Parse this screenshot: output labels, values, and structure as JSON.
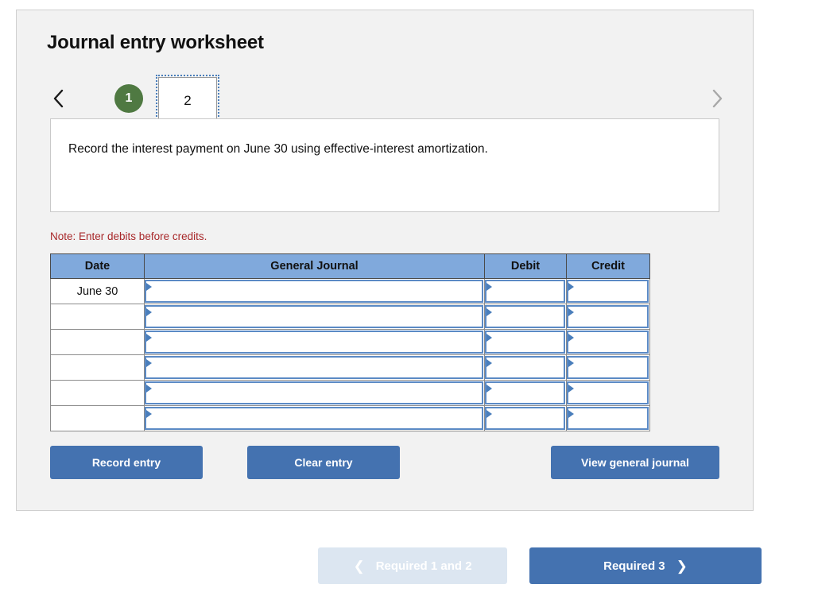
{
  "panel": {
    "title": "Journal entry worksheet"
  },
  "tabs": {
    "prev_icon": "chevron-left-icon",
    "next_icon": "chevron-right-icon",
    "items": [
      {
        "label": "1",
        "state": "completed"
      },
      {
        "label": "2",
        "state": "active"
      }
    ]
  },
  "instruction": {
    "text": "Record the interest payment on June 30 using effective-interest amortization."
  },
  "note": {
    "text": "Note: Enter debits before credits."
  },
  "journal": {
    "columns": [
      "Date",
      "General Journal",
      "Debit",
      "Credit"
    ],
    "rows": [
      {
        "date": "June 30",
        "general_journal": "",
        "debit": "",
        "credit": ""
      },
      {
        "date": "",
        "general_journal": "",
        "debit": "",
        "credit": ""
      },
      {
        "date": "",
        "general_journal": "",
        "debit": "",
        "credit": ""
      },
      {
        "date": "",
        "general_journal": "",
        "debit": "",
        "credit": ""
      },
      {
        "date": "",
        "general_journal": "",
        "debit": "",
        "credit": ""
      },
      {
        "date": "",
        "general_journal": "",
        "debit": "",
        "credit": ""
      }
    ]
  },
  "actions": {
    "record_label": "Record entry",
    "clear_label": "Clear entry",
    "view_label": "View general journal"
  },
  "footer": {
    "prev_label": "Required 1 and 2",
    "next_label": "Required 3",
    "prev_icon": "chevron-left-icon",
    "next_icon": "chevron-right-icon",
    "prev_disabled": true
  },
  "colors": {
    "panel_bg": "#f2f2f2",
    "table_header_blue": "#80a9dc",
    "button_blue": "#4472b0",
    "disabled_blue": "#dce6f1",
    "tab_green": "#4f7942",
    "note_red": "#a8282a",
    "cell_border_blue": "#5b8ac5"
  }
}
